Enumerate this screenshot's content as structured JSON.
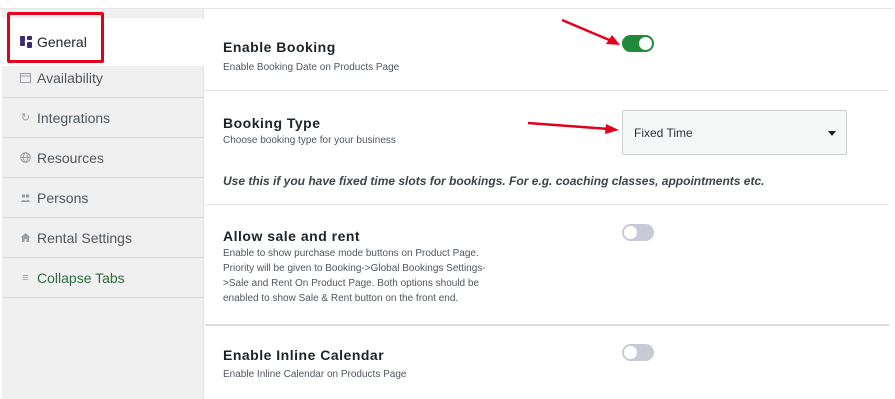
{
  "sidebar": {
    "items": [
      {
        "label": "General",
        "icon": "grid-icon"
      },
      {
        "label": "Availability",
        "icon": "calendar-icon"
      },
      {
        "label": "Integrations",
        "icon": "sync-icon"
      },
      {
        "label": "Resources",
        "icon": "globe-icon"
      },
      {
        "label": "Persons",
        "icon": "users-icon"
      },
      {
        "label": "Rental Settings",
        "icon": "home-icon"
      },
      {
        "label": "Collapse Tabs",
        "icon": "menu-icon"
      }
    ],
    "active_index": 0
  },
  "settings": {
    "enable_booking": {
      "title": "Enable Booking",
      "desc": "Enable Booking Date on Products Page",
      "enabled": true
    },
    "booking_type": {
      "title": "Booking Type",
      "desc": "Choose booking type for your business",
      "selected": "Fixed Time",
      "note": "Use this if you have fixed time slots for bookings. For e.g. coaching classes, appointments etc."
    },
    "allow_sale_rent": {
      "title": "Allow sale and rent",
      "desc_lines": [
        "Enable to show purchase mode buttons on Product Page.",
        "Priority will be given to Booking->Global Bookings Settings-",
        ">Sale and Rent On Product Page. Both options should be",
        "enabled to show Sale & Rent button on the front end."
      ],
      "enabled": false
    },
    "inline_calendar": {
      "title": "Enable Inline Calendar",
      "desc": "Enable Inline Calendar on Products Page",
      "enabled": false
    }
  },
  "colors": {
    "toggle_on": "#1e8a3a",
    "toggle_off": "#c6cbd6",
    "highlight": "#e3001b",
    "collapse_link": "#2e6b3f"
  }
}
